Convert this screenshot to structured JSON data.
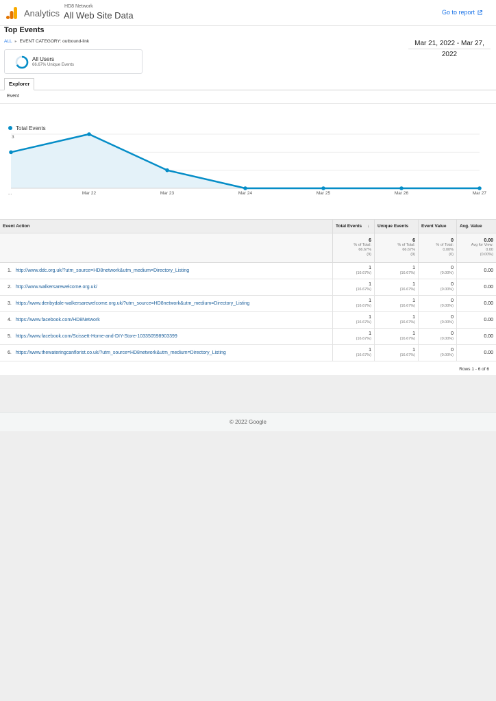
{
  "header": {
    "brand": "Analytics",
    "account": "HD8 Network",
    "property": "All Web Site Data",
    "goto_report": "Go to report"
  },
  "report": {
    "title": "Top Events",
    "breadcrumb_all": "ALL",
    "breadcrumb_current": "EVENT CATEGORY: outbound-link",
    "date_range": "Mar 21, 2022 - Mar 27, 2022"
  },
  "segment": {
    "name": "All Users",
    "detail": "66.67% Unique Events",
    "fraction": 0.6667
  },
  "tabs": {
    "explorer": "Explorer",
    "sub": "Event"
  },
  "chart_data": {
    "type": "area",
    "series": [
      {
        "name": "Total Events",
        "values": [
          2,
          3,
          1,
          0,
          0,
          0,
          0
        ]
      }
    ],
    "categories": [
      "...",
      "Mar 22",
      "Mar 23",
      "Mar 24",
      "Mar 25",
      "Mar 26",
      "Mar 27"
    ],
    "yticks": [
      "1",
      "2",
      "3"
    ],
    "ylim": [
      0,
      3
    ],
    "legend_position": "top-left",
    "grid": true,
    "color": "#058dc7"
  },
  "table": {
    "columns": {
      "action": "Event Action",
      "total": "Total Events",
      "unique": "Unique Events",
      "value": "Event Value",
      "avg": "Avg. Value"
    },
    "totals": {
      "total": {
        "value": "6",
        "line1": "% of Total:",
        "line2": "66.67%",
        "line3": "(9)"
      },
      "unique": {
        "value": "6",
        "line1": "% of Total:",
        "line2": "66.67%",
        "line3": "(9)"
      },
      "value": {
        "value": "0",
        "line1": "% of Total:",
        "line2": "0.00%",
        "line3": "(0)"
      },
      "avg": {
        "value": "0.00",
        "line1": "Avg for View:",
        "line2": "0.00",
        "line3": "(0.00%)"
      }
    },
    "rows": [
      {
        "index": "1.",
        "action": "http://www.ddc.org.uk/?utm_source=HD8network&utm_medium=Directory_Listing",
        "total": "1",
        "total_pct": "(16.67%)",
        "unique": "1",
        "unique_pct": "(16.67%)",
        "value": "0",
        "value_pct": "(0.00%)",
        "avg": "0.00"
      },
      {
        "index": "2.",
        "action": "http://www.walkersarewelcome.org.uk/",
        "total": "1",
        "total_pct": "(16.67%)",
        "unique": "1",
        "unique_pct": "(16.67%)",
        "value": "0",
        "value_pct": "(0.00%)",
        "avg": "0.00"
      },
      {
        "index": "3.",
        "action": "https://www.denbydale-walkersarewelcome.org.uk/?utm_source=HD8network&utm_medium=Directory_Listing",
        "total": "1",
        "total_pct": "(16.67%)",
        "unique": "1",
        "unique_pct": "(16.67%)",
        "value": "0",
        "value_pct": "(0.00%)",
        "avg": "0.00"
      },
      {
        "index": "4.",
        "action": "https://www.facebook.com/HD8Network",
        "total": "1",
        "total_pct": "(16.67%)",
        "unique": "1",
        "unique_pct": "(16.67%)",
        "value": "0",
        "value_pct": "(0.00%)",
        "avg": "0.00"
      },
      {
        "index": "5.",
        "action": "https://www.facebook.com/Scissett-Home-and-DIY-Store-103350598903399",
        "total": "1",
        "total_pct": "(16.67%)",
        "unique": "1",
        "unique_pct": "(16.67%)",
        "value": "0",
        "value_pct": "(0.00%)",
        "avg": "0.00"
      },
      {
        "index": "6.",
        "action": "https://www.thewateringcanflorist.co.uk/?utm_source=HD8network&utm_medium=Directory_Listing",
        "total": "1",
        "total_pct": "(16.67%)",
        "unique": "1",
        "unique_pct": "(16.67%)",
        "value": "0",
        "value_pct": "(0.00%)",
        "avg": "0.00"
      }
    ],
    "pagination": "Rows 1 - 6 of 6"
  },
  "footer": {
    "copyright": "© 2022 Google"
  },
  "colors": {
    "accent": "#1a73e8",
    "series": "#058dc7",
    "logo_orange": "#f9ab00",
    "logo_dark_orange": "#e37400"
  },
  "icons": {
    "logo": "analytics-logo-icon",
    "goto": "external-link-icon",
    "sort": "sort-down-arrow-icon",
    "segment": "donut-ring-icon"
  }
}
